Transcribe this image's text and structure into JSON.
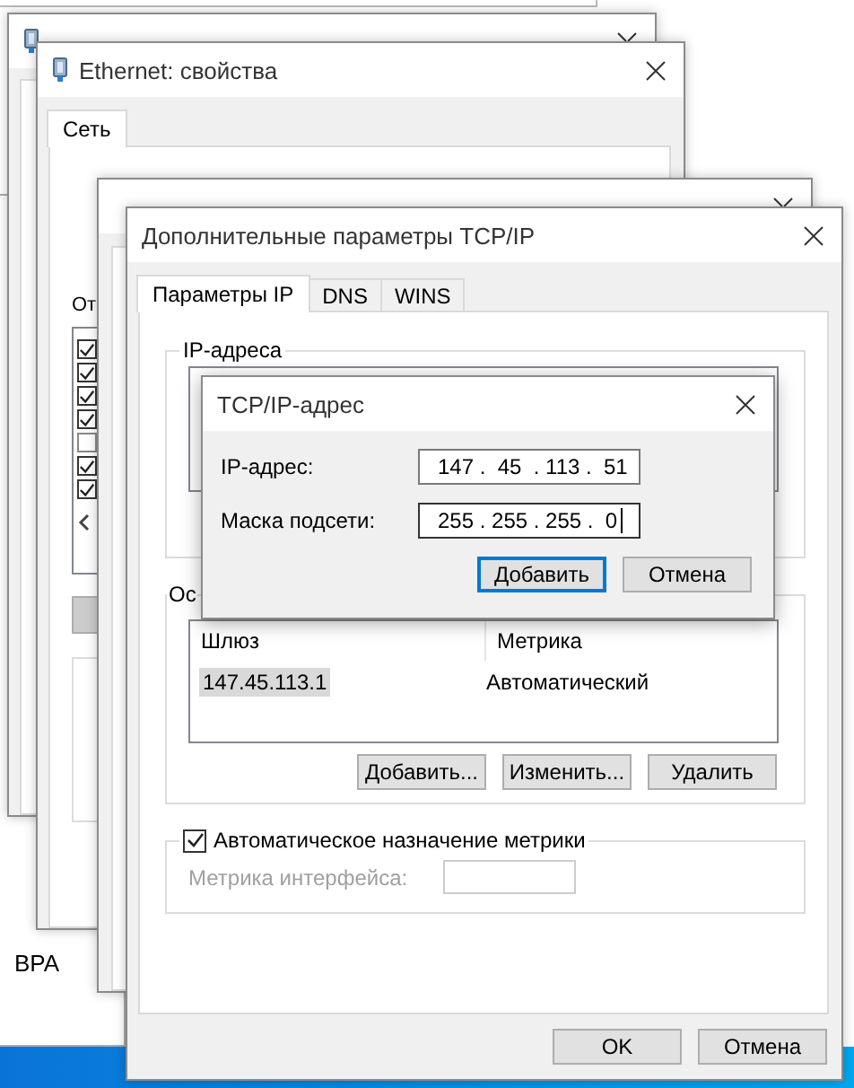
{
  "background_window": {
    "text": "BPA"
  },
  "properties_window": {
    "title": "Ethernet: свойства",
    "tabs": [
      {
        "label": "Сеть",
        "selected": true
      }
    ],
    "list_caption": "От",
    "components": [
      {
        "checked": true
      },
      {
        "checked": true
      },
      {
        "checked": true
      },
      {
        "checked": true
      },
      {
        "checked": false
      },
      {
        "checked": true
      },
      {
        "checked": true
      }
    ]
  },
  "advanced_window": {
    "title": "Дополнительные параметры TCP/IP",
    "tabs": [
      {
        "label": "Параметры IP",
        "selected": true
      },
      {
        "label": "DNS",
        "selected": false
      },
      {
        "label": "WINS",
        "selected": false
      }
    ],
    "ip_group": {
      "title": "IP-адреса"
    },
    "gateway_group": {
      "title": "Ос",
      "columns": [
        "Шлюз",
        "Метрика"
      ],
      "rows": [
        {
          "cells": [
            "147.45.113.1",
            "Автоматический"
          ],
          "selected": true
        }
      ],
      "buttons": [
        "Добавить...",
        "Изменить...",
        "Удалить"
      ]
    },
    "auto_metric": {
      "label": "Автоматическое назначение метрики",
      "checked": true
    },
    "interface_metric": {
      "label": "Метрика интерфейса:",
      "disabled": true
    },
    "buttons": [
      "OK",
      "Отмена"
    ]
  },
  "address_dialog": {
    "title": "TCP/IP-адрес",
    "fields": [
      {
        "label": "IP-адрес:",
        "value": "147 .  45  . 113 .  51",
        "focused": false
      },
      {
        "label": "Маска подсети:",
        "value": "255 . 255 . 255 .  0",
        "focused": true
      }
    ],
    "buttons": [
      {
        "label": "Добавить",
        "default": true
      },
      {
        "label": "Отмена",
        "default": false
      }
    ]
  }
}
